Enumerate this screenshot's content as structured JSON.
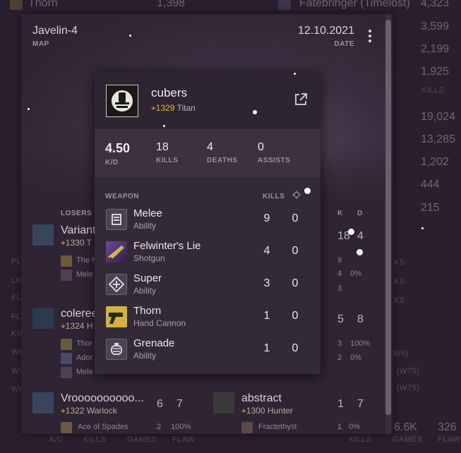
{
  "background": {
    "top_left_weapon": "Thorn",
    "top_left_kills": "1,398",
    "top_right_weapon": "Fatebringer (Timelost)",
    "top_right_kills": "4,323",
    "right_numbers": [
      "3,599",
      "2,199",
      "1,925",
      "19,024",
      "13,285",
      "1,202",
      "444",
      "215"
    ],
    "right_kills_label": "KILLS",
    "bottom_left_labels": [
      "K/D",
      "KILLS",
      "GAMES",
      "FLAW"
    ],
    "bottom_right_values": [
      "6.6K",
      "326"
    ]
  },
  "card": {
    "map_name": "Javelin-4",
    "map_label": "MAP",
    "date_value": "12.10.2021",
    "date_label": "DATE",
    "losers_label": "LOSERS",
    "k_label": "K",
    "d_label": "D",
    "players_left": [
      {
        "name": "Variant",
        "power": "1330",
        "class": "T",
        "weapons": [
          "The N",
          "Mele"
        ]
      },
      {
        "name": "coleree",
        "power": "1324",
        "class": "H",
        "weapons": [
          "Thor",
          "Ador",
          "Mele"
        ]
      },
      {
        "name": "Vroooooooooo...",
        "power": "1322",
        "class": "Warlock",
        "kills": "6",
        "deaths": "7",
        "weapons": [
          "Ace of Spades"
        ],
        "weapon_stats": [
          "2",
          "100%"
        ]
      }
    ],
    "players_right": [
      {
        "kills": "18",
        "deaths": "4",
        "weapon_stats": [
          [
            "9",
            ""
          ],
          [
            "4",
            "0%"
          ],
          [
            "3",
            ""
          ]
        ]
      },
      {
        "kills": "5",
        "deaths": "8",
        "weapon_stats": [
          [
            "3",
            "100%"
          ],
          [
            "2",
            "0%"
          ]
        ]
      },
      {
        "name": "abstract",
        "power": "1300",
        "class": "Hunter",
        "kills": "1",
        "deaths": "7",
        "weapons": [
          "Fractethyst"
        ],
        "weapon_stats": [
          "1",
          "0%"
        ]
      }
    ],
    "side_labels": [
      "PL",
      "LIG",
      "FL",
      "FL",
      "KIL",
      "WI",
      "WI",
      "WI"
    ],
    "right_side_labels": [
      "KS",
      "KS",
      "KS",
      "(W5)",
      "(W75)",
      "(W75)"
    ]
  },
  "popup": {
    "player_name": "cubers",
    "power": "1329",
    "player_class": "Titan",
    "stats": [
      {
        "value": "4.50",
        "label": "K/D"
      },
      {
        "value": "18",
        "label": "KILLS"
      },
      {
        "value": "4",
        "label": "DEATHS"
      },
      {
        "value": "0",
        "label": "ASSISTS"
      }
    ],
    "weapon_header": "WEAPON",
    "kills_header": "KILLS",
    "precision_icon": "crosshair-icon",
    "weapons": [
      {
        "name": "Melee",
        "type": "Ability",
        "kills": "9",
        "precision": "0",
        "icon": "melee-ability-icon"
      },
      {
        "name": "Felwinter's Lie",
        "type": "Shotgun",
        "kills": "4",
        "precision": "0",
        "icon": "shotgun-icon"
      },
      {
        "name": "Super",
        "type": "Ability",
        "kills": "3",
        "precision": "0",
        "icon": "super-ability-icon"
      },
      {
        "name": "Thorn",
        "type": "Hand Cannon",
        "kills": "1",
        "precision": "0",
        "icon": "hand-cannon-icon"
      },
      {
        "name": "Grenade",
        "type": "Ability",
        "kills": "1",
        "precision": "0",
        "icon": "grenade-ability-icon"
      }
    ],
    "external_link_icon": "external-link-icon"
  },
  "colors": {
    "page_bg": "#2a1f2e",
    "popup_bg": "#332a37",
    "power_accent": "#e5b73b"
  }
}
